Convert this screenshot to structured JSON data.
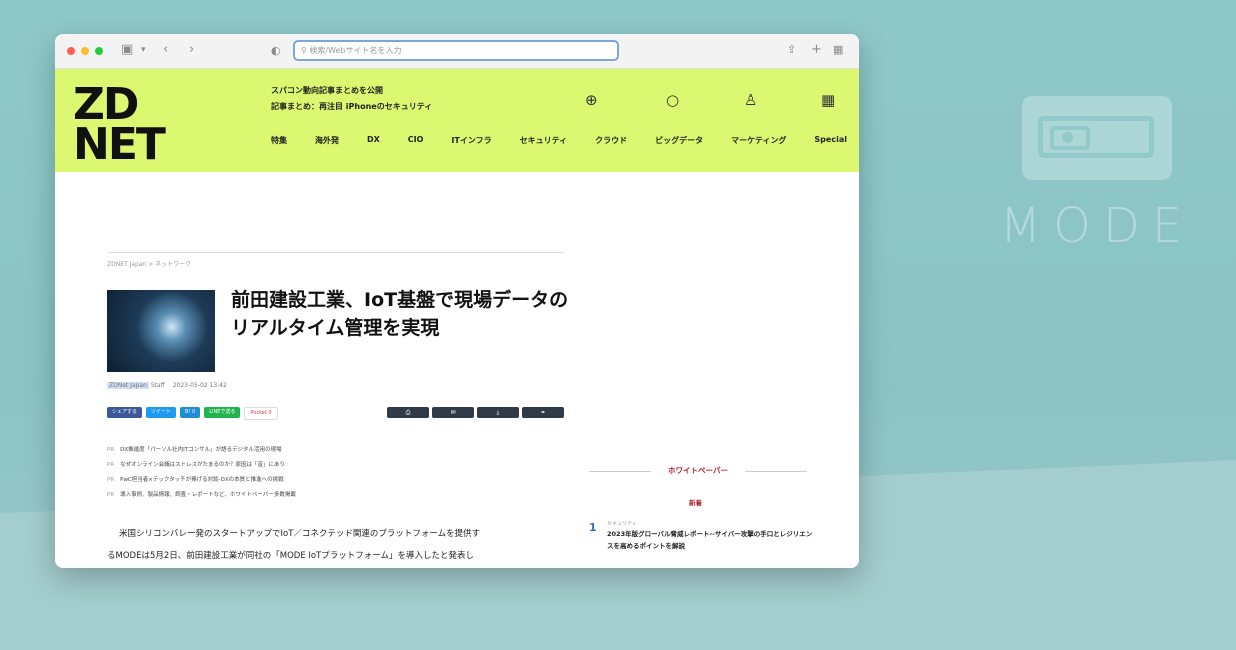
{
  "browser": {
    "address_placeholder": "検索/Webサイト名を入力",
    "colors": {
      "close": "#ff5f57",
      "minimize": "#febc2e",
      "maximize": "#28c840",
      "address_border": "#7aa6dd"
    }
  },
  "site": {
    "logo_line1": "ZD",
    "logo_line2": "NET",
    "headlines": [
      "スパコン動向記事まとめを公開",
      "記事まとめ：再注目 iPhoneのセキュリティ"
    ],
    "icons": [
      "globe-icon",
      "search-icon",
      "user-icon",
      "grid-icon"
    ],
    "nav": [
      "特集",
      "海外発",
      "DX",
      "CIO",
      "ITインフラ",
      "セキュリティ",
      "クラウド",
      "ビッグデータ",
      "マーケティング",
      "Special"
    ],
    "accent": "#dcf870"
  },
  "article": {
    "breadcrumb": "ZDNET Japan > ネットワーク",
    "title": "前田建設工業、IoT基盤で現場データのリアルタイム管理を実現",
    "author": "ZDNet Japan",
    "author_suffix": " Staff",
    "date": "2023-05-02 13:42",
    "share_buttons": [
      "シェアする",
      "ツイート",
      "B! 0",
      "LINEで送る",
      "Pocket  0"
    ],
    "tools": [
      "print",
      "mail",
      "download",
      "link"
    ],
    "related": [
      {
        "prefix": "PR",
        "text": "DX推進度「パーソル社内ITコンサル」が語るデジタル活用の現場"
      },
      {
        "prefix": "PR",
        "text": "なぜオンライン会議はストレスがたまるのか？原因は「音」にあり"
      },
      {
        "prefix": "PR",
        "text": "PwC担当者×テックタッチが捧げる対談-DXの本質と推進への挑戦"
      },
      {
        "prefix": "PR",
        "text": "導入事例、製品情報、調査・レポートなど、ホワイトペーパー多数掲載"
      }
    ],
    "body_line1": "米国シリコンバレー発のスタートアップでIoT／コネクテッド関連のプラットフォームを提供す",
    "body_line2": "るMODEは5月2日、前田建設工業が同社の「MODE IoTプラットフォーム」を導入したと発表し"
  },
  "sidebar": {
    "heading": "ホワイトペーパー",
    "tab": "新着",
    "item_number": "1",
    "item_category": "セキュリティ",
    "item_title": "2023年版グローバル脅威レポート--サイバー攻撃の手口とレジリエンスを高めるポイントを解説"
  },
  "brand_watermark": {
    "text": "MODE"
  }
}
